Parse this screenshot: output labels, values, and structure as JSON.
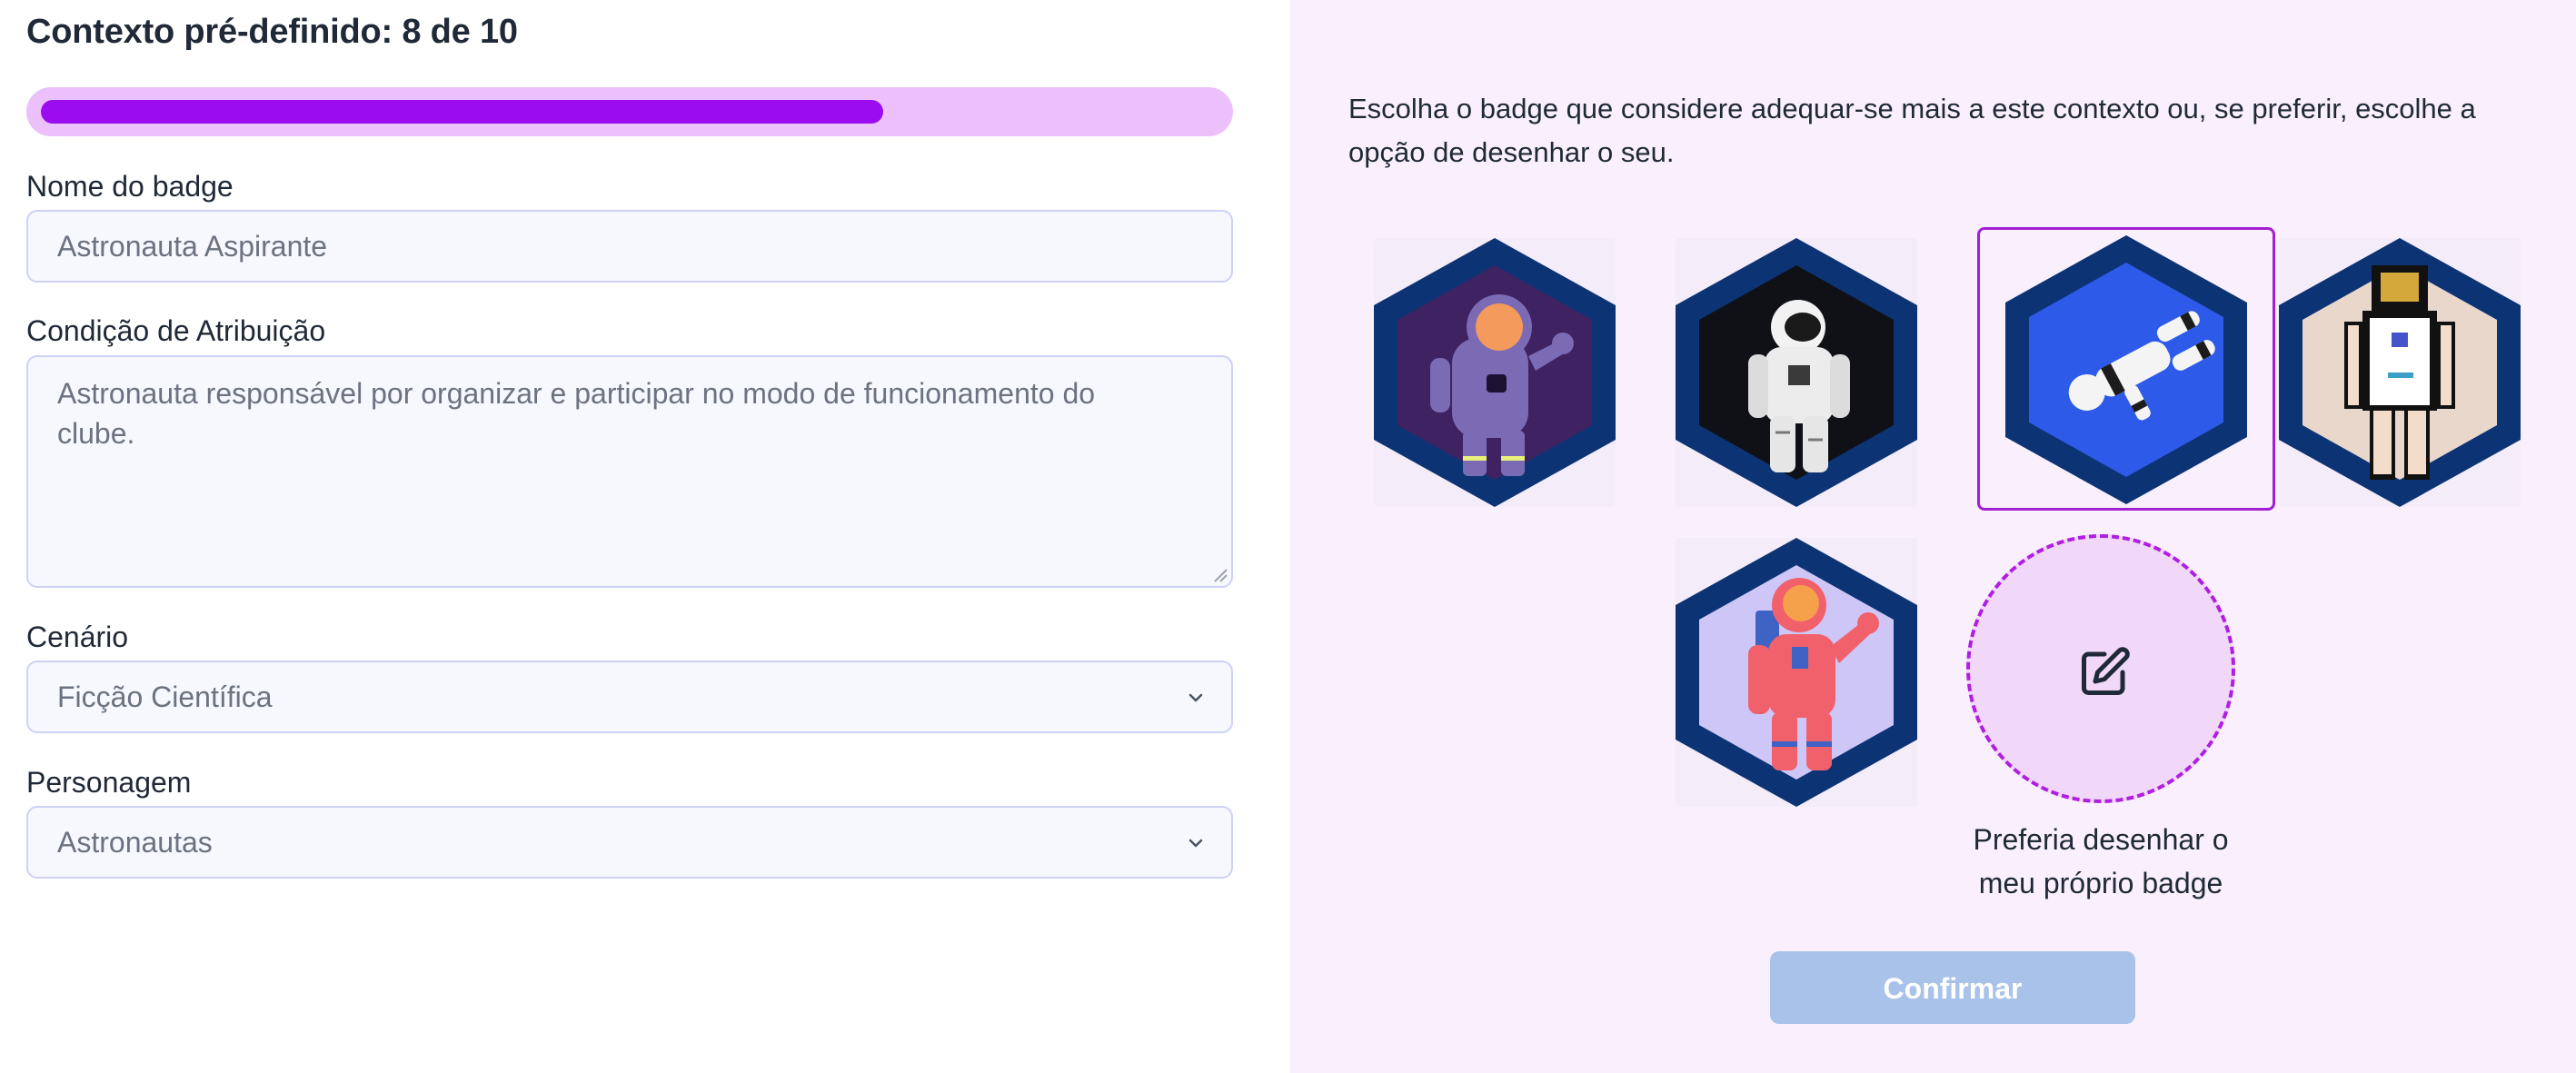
{
  "header": {
    "title": "Contexto pré-definido: 8 de 10"
  },
  "progress": {
    "current": 8,
    "total": 10,
    "fraction": 0.715
  },
  "form": {
    "badge_name_label": "Nome do badge",
    "badge_name_value": "Astronauta Aspirante",
    "condition_label": "Condição de Atribuição",
    "condition_value": "Astronauta responsável por organizar e participar no modo de funcionamento do clube.",
    "scenario_label": "Cenário",
    "scenario_value": "Ficção Científica",
    "character_label": "Personagem",
    "character_value": "Astronautas"
  },
  "badge_picker": {
    "instruction": "Escolha o badge que considere adequar-se mais a este contexto ou, se preferir, escolhe a opção de desenhar o seu.",
    "badges": [
      {
        "name": "astronaut-purple-badge",
        "inner": "#3e2262",
        "selected": false
      },
      {
        "name": "astronaut-realistic-badge",
        "inner": "#0f1117",
        "selected": false
      },
      {
        "name": "astronaut-floating-badge",
        "inner": "#2d5ae8",
        "selected": true
      },
      {
        "name": "astronaut-pixel-badge",
        "inner": "#ead7cc",
        "selected": false
      },
      {
        "name": "astronaut-pink-badge",
        "inner": "#cfc6f8",
        "selected": false
      }
    ],
    "hex_border_color": "#0c3475",
    "draw_own_label": "Preferia desenhar o meu próprio badge",
    "draw_icon": "edit-icon",
    "confirm_label": "Confirmar"
  },
  "colors": {
    "accent": "#9b0cf0",
    "progress_track": "#ebc0fb",
    "right_panel_bg": "#faf0fd",
    "confirm_disabled": "#a9c2e9"
  }
}
